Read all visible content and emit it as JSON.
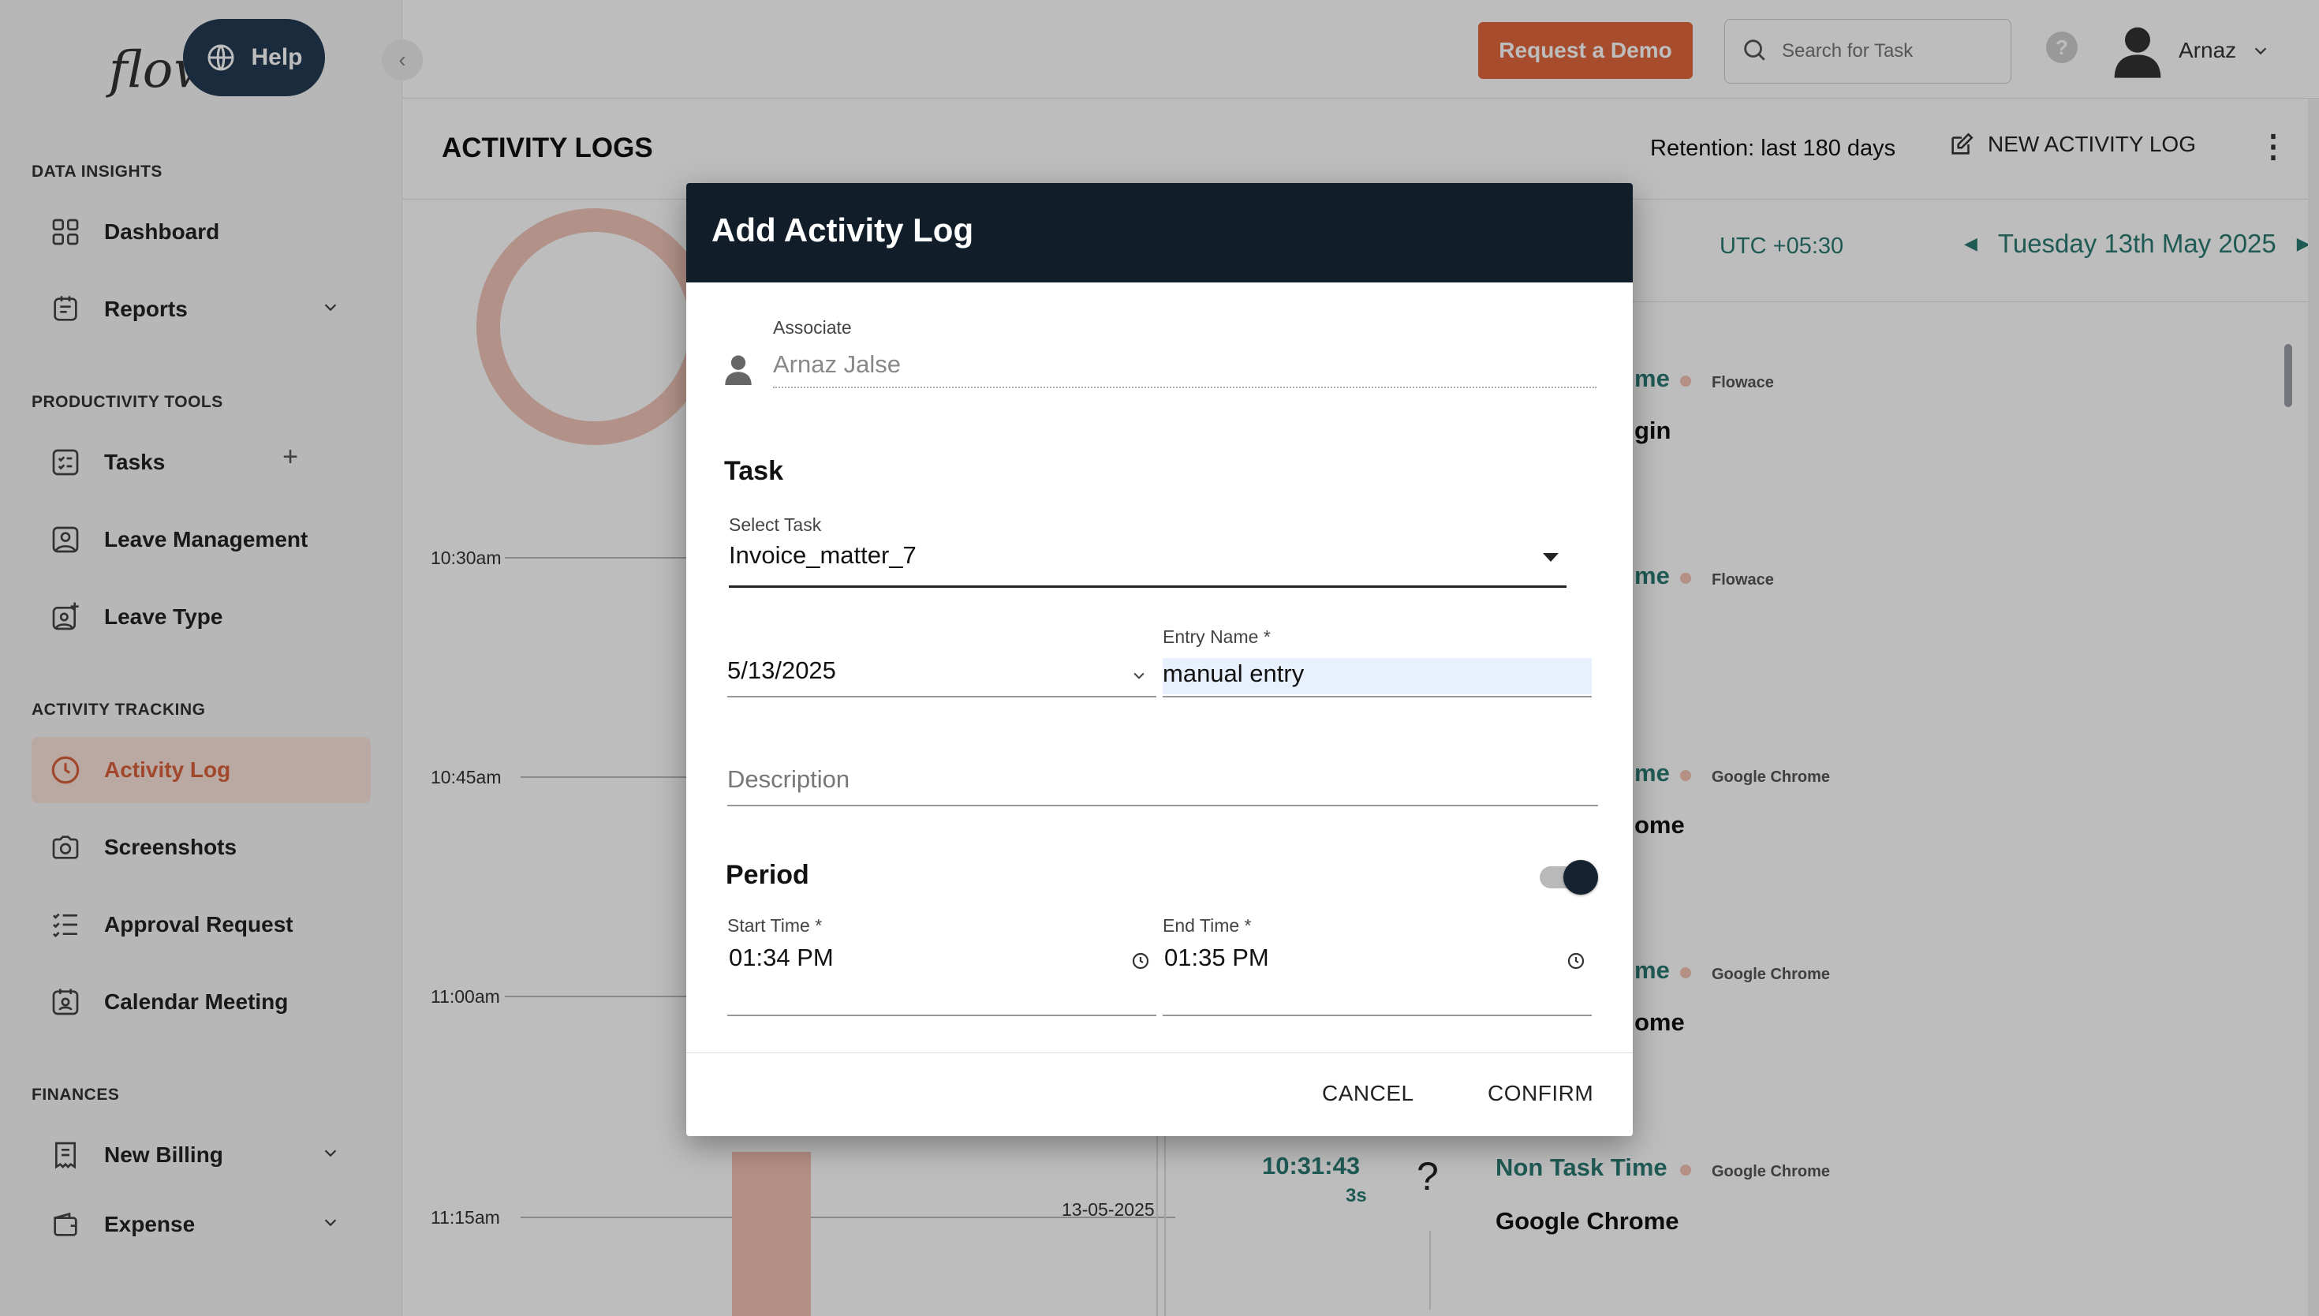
{
  "sidebar": {
    "logo": "flow",
    "help_label": "Help",
    "sections": {
      "data_insights": "DATA INSIGHTS",
      "productivity_tools": "PRODUCTIVITY TOOLS",
      "activity_tracking": "ACTIVITY TRACKING",
      "finances": "FINANCES"
    },
    "items": {
      "dashboard": "Dashboard",
      "reports": "Reports",
      "tasks": "Tasks",
      "leave_management": "Leave Management",
      "leave_type": "Leave Type",
      "activity_log": "Activity Log",
      "screenshots": "Screenshots",
      "approval_request": "Approval Request",
      "calendar_meeting": "Calendar Meeting",
      "new_billing": "New Billing",
      "expense": "Expense"
    },
    "active_item": "activity_log"
  },
  "header": {
    "demo_label": "Request a Demo",
    "search_placeholder": "Search for Task",
    "help_glyph": "?",
    "user_name": "Arnaz"
  },
  "page": {
    "title": "ACTIVITY LOGS",
    "retention": "Retention: last 180 days",
    "new_log_label": "NEW ACTIVITY LOG",
    "timezone": "UTC +05:30",
    "date": "Tuesday 13th May 2025"
  },
  "timeline": {
    "labels": [
      "10:30am",
      "10:45am",
      "11:00am",
      "11:15am"
    ],
    "date_stamp": "13-05-2025"
  },
  "entries": [
    {
      "title_fragment": "me",
      "app": "Flowace",
      "sub_fragment": "gin"
    },
    {
      "title_fragment": "me",
      "app": "Flowace",
      "sub_fragment": ""
    },
    {
      "title_fragment": "me",
      "app": "Google Chrome",
      "sub_fragment": "ome"
    },
    {
      "title_fragment": "me",
      "app": "Google Chrome",
      "sub_fragment": "ome"
    },
    {
      "time": "10:31:43",
      "duration": "3s",
      "glyph": "?",
      "title": "Non Task Time",
      "app": "Google Chrome",
      "sub": "Google Chrome"
    }
  ],
  "modal": {
    "title": "Add Activity Log",
    "associate_label": "Associate",
    "associate_value": "Arnaz Jalse",
    "task_heading": "Task",
    "select_task_label": "Select Task",
    "select_task_value": "Invoice_matter_7",
    "date_value": "5/13/2025",
    "entry_name_label": "Entry Name *",
    "entry_name_value": "manual entry",
    "description_placeholder": "Description",
    "period_heading": "Period",
    "period_enabled": true,
    "start_time_label": "Start Time *",
    "start_time_value": "01:34 PM",
    "end_time_label": "End Time *",
    "end_time_value": "01:35 PM",
    "cancel_label": "CANCEL",
    "confirm_label": "CONFIRM"
  },
  "colors": {
    "accent": "#e2693f",
    "teal": "#2b7a73",
    "modal_header": "#111e29",
    "help_button": "#243b53",
    "active_bg": "#fbe4db"
  }
}
